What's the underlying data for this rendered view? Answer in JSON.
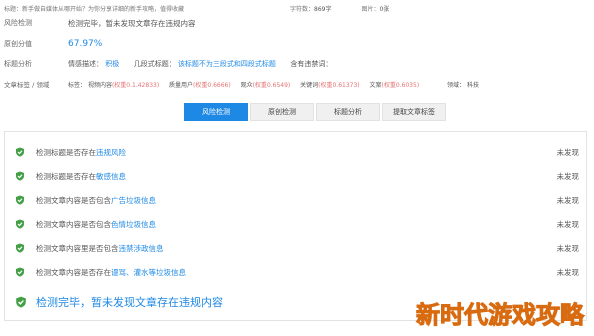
{
  "topbar": {
    "title": "标题：新手做自媒体从哪开始？为你分享详细的新手攻略，值得收藏",
    "char_count_label": "字符数：",
    "char_count": "869字",
    "image_label": "图片：",
    "image_count": "0张"
  },
  "risk": {
    "label": "风险检测",
    "value": "检测完毕，暂未发现文章存在违规内容"
  },
  "originality": {
    "label": "原创分值",
    "value": "67.97%"
  },
  "title_analysis": {
    "label": "标题分析",
    "emotion_label": "情感描述：",
    "emotion_value": "积极",
    "paragraph_label": "几段式标题：",
    "paragraph_value": "该标题不为三段式和四段式标题",
    "sensitive_label": "含有违禁词："
  },
  "tags": {
    "label": "文章标签 / 领域",
    "tag_label": "标签：",
    "items": [
      {
        "name": "视频内容",
        "weight": "(权重0.1.42833)"
      },
      {
        "name": "质量用户",
        "weight": "(权重0.6666)"
      },
      {
        "name": "观众",
        "weight": "(权重0.6549)"
      },
      {
        "name": "关键词",
        "weight": "(权重0.61373)"
      },
      {
        "name": "文案",
        "weight": "(权重0.6035)"
      }
    ],
    "domain_label": "领域：",
    "domain_value": "科技"
  },
  "tabs": [
    "风险检测",
    "原创检测",
    "标题分析",
    "提取文章标签"
  ],
  "checks": [
    {
      "prefix": "检测标题是否存在",
      "keyword": "违规风险",
      "suffix": "",
      "result": "未发现"
    },
    {
      "prefix": "检测标题是否存在",
      "keyword": "敏感信息",
      "suffix": "",
      "result": "未发现"
    },
    {
      "prefix": "检测文章内容是否包含",
      "keyword": "广告垃圾信息",
      "suffix": "",
      "result": "未发现"
    },
    {
      "prefix": "检测文章内容是否包含",
      "keyword": "色情垃圾信息",
      "suffix": "",
      "result": "未发现"
    },
    {
      "prefix": "检测文章内容里是否包含",
      "keyword": "违禁涉政信息",
      "suffix": "",
      "result": "未发现"
    },
    {
      "prefix": "检测文章内容是否存在",
      "keyword": "谩骂、灌水等垃圾信息",
      "suffix": "",
      "result": "未发现"
    }
  ],
  "summary": "检测完毕，暂未发现文章存在违规内容",
  "watermark": "新时代游戏攻略",
  "colors": {
    "accent": "#1e88e5",
    "success": "#43a047",
    "watermark": "#f28a2e"
  }
}
